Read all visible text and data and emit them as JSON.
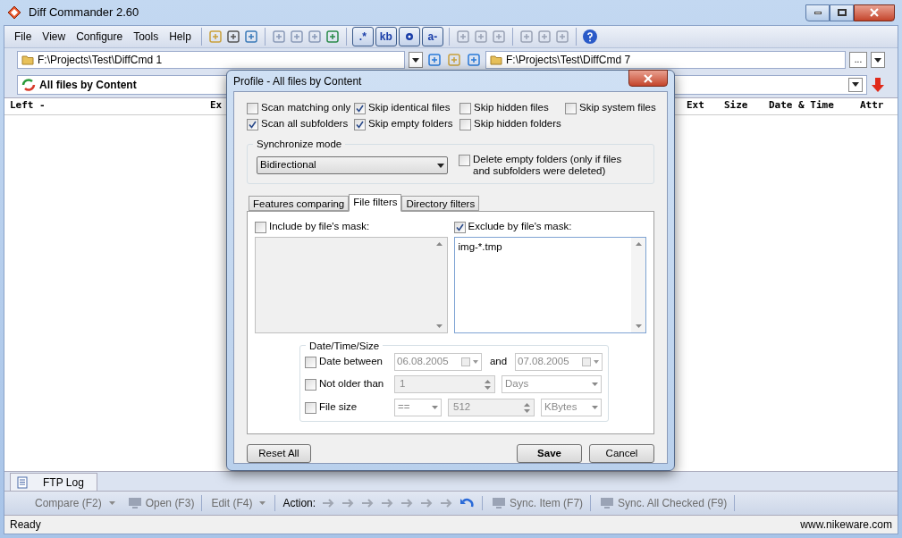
{
  "window": {
    "title": "Diff Commander 2.60"
  },
  "menu": [
    "File",
    "View",
    "Configure",
    "Tools",
    "Help"
  ],
  "toolbar_toggles": [
    {
      "label": ".*",
      "kind": "text"
    },
    {
      "label": "kb",
      "kind": "text"
    },
    {
      "kind": "icon"
    },
    {
      "label": "a-",
      "kind": "text"
    }
  ],
  "left_path": "F:\\Projects\\Test\\DiffCmd 1",
  "right_path": "F:\\Projects\\Test\\DiffCmd 7",
  "browse_button": "...",
  "profile": "All files by Content",
  "left_columns": [
    "Left -",
    "Ex"
  ],
  "right_columns": [
    "Ext",
    "Size",
    "Date & Time",
    "Attr"
  ],
  "bottom_tabs": [
    {
      "label": "FTP Log",
      "selected": true
    }
  ],
  "action_bar": [
    {
      "kind": "dropdown",
      "label": "Compare (F2)",
      "disabled": true
    },
    {
      "kind": "button",
      "label": "Open (F3)",
      "disabled": true
    },
    {
      "kind": "dropdown",
      "label": "Edit (F4)",
      "disabled": true
    },
    {
      "kind": "label",
      "label": "Action:",
      "disabled": false
    },
    {
      "kind": "icons",
      "disabled": true
    },
    {
      "kind": "button",
      "label": "Sync. Item (F7)",
      "disabled": true
    },
    {
      "kind": "button",
      "label": "Sync. All Checked (F9)",
      "disabled": true
    }
  ],
  "status_bar": {
    "left": "Ready",
    "right": "www.nikeware.com"
  },
  "dialog": {
    "title": "Profile - All files by Content",
    "options": [
      {
        "label": "Scan matching only",
        "checked": false
      },
      {
        "label": "Skip identical files",
        "checked": true
      },
      {
        "label": "Skip hidden files",
        "checked": false
      },
      {
        "label": "Skip system files",
        "checked": false
      },
      {
        "label": "Scan all subfolders",
        "checked": true
      },
      {
        "label": "Skip empty folders",
        "checked": true
      },
      {
        "label": "Skip hidden folders",
        "checked": false
      }
    ],
    "sync_mode": {
      "title": "Synchronize mode",
      "value": "Bidirectional"
    },
    "delete_empty": {
      "label": "Delete empty folders (only if files and subfolders were deleted)",
      "checked": false
    },
    "tabs": [
      {
        "label": "Features comparing",
        "selected": false
      },
      {
        "label": "File filters",
        "selected": true
      },
      {
        "label": "Directory filters",
        "selected": false
      }
    ],
    "include": {
      "label": "Include by file's mask:",
      "checked": false
    },
    "exclude": {
      "label": "Exclude by file's mask:",
      "checked": true,
      "value": "img-*.tmp"
    },
    "dts": {
      "title": "Date/Time/Size",
      "date_between": {
        "label": "Date between",
        "checked": false,
        "from": "06.08.2005",
        "joiner": "and",
        "to": "07.08.2005"
      },
      "not_older": {
        "label": "Not older than",
        "checked": false,
        "value": "1",
        "unit": "Days"
      },
      "file_size": {
        "label": "File size",
        "checked": false,
        "op": "==",
        "value": "512",
        "unit": "KBytes"
      }
    },
    "buttons": {
      "reset": "Reset All",
      "save": "Save",
      "cancel": "Cancel"
    }
  }
}
